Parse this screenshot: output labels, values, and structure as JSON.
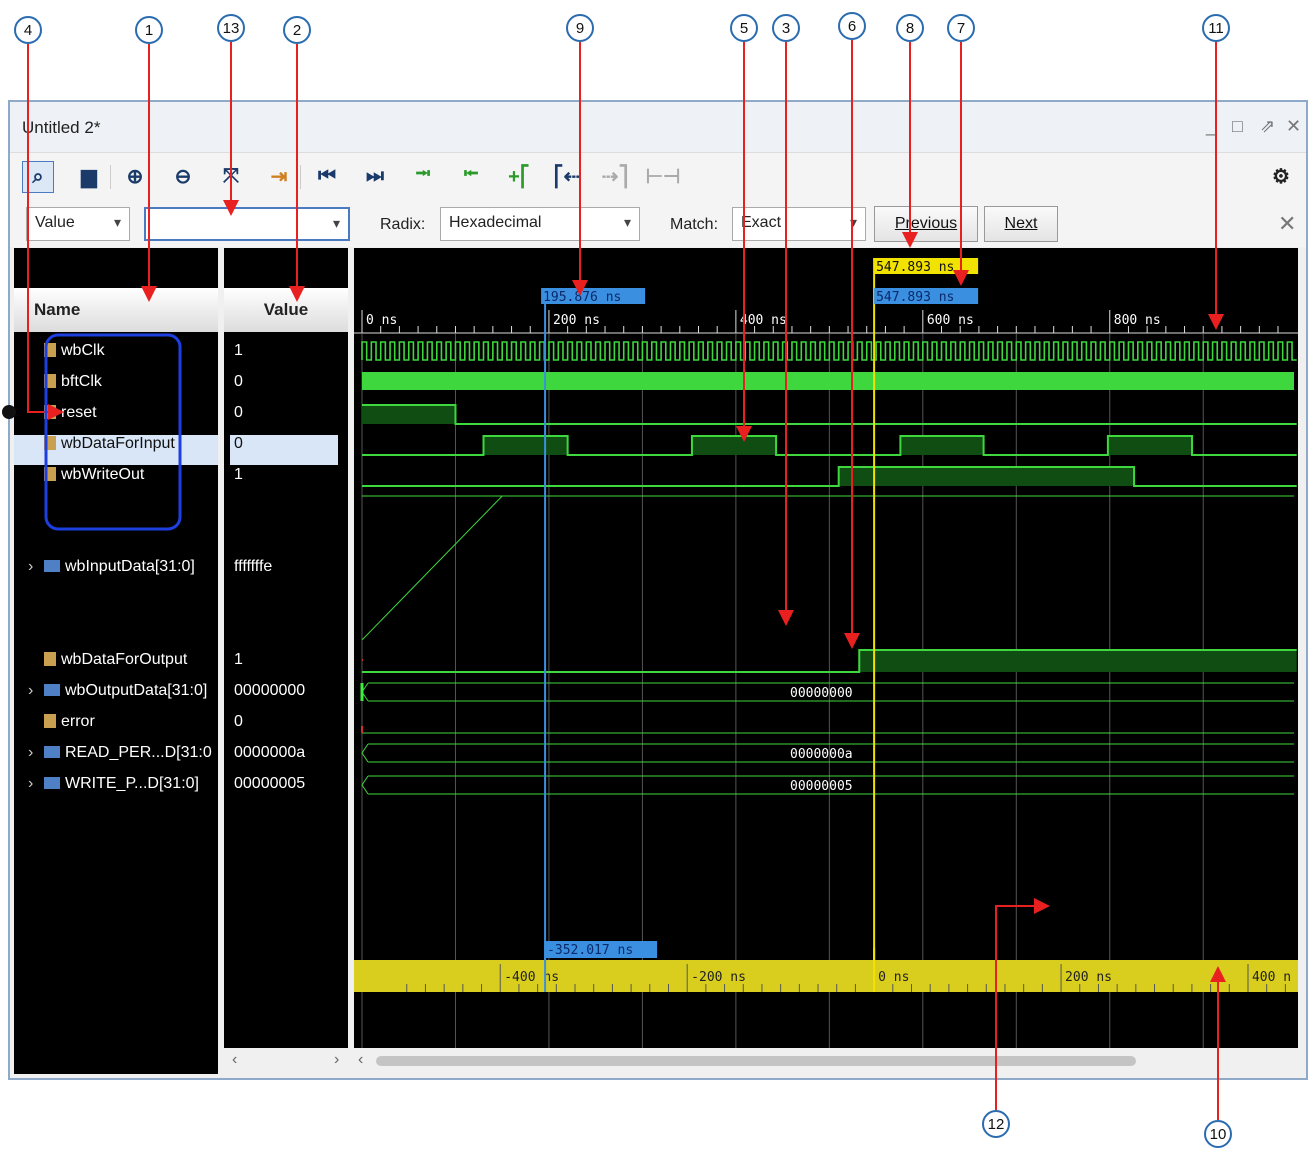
{
  "window": {
    "title": "Untitled 2*"
  },
  "toolbar": {
    "icons": [
      "search-icon",
      "save-icon",
      "zoom-in-icon",
      "zoom-out-icon",
      "zoom-fit-icon",
      "go-to-cursor-icon",
      "go-to-time-0-icon",
      "go-to-last-time-icon",
      "previous-transition-icon",
      "next-transition-icon",
      "add-marker-icon",
      "previous-marker-icon",
      "next-marker-icon",
      "swap-cursors-icon",
      "settings-icon"
    ]
  },
  "findbar": {
    "mode": "Value",
    "search_value": "",
    "radix_label": "Radix:",
    "radix": "Hexadecimal",
    "match_label": "Match:",
    "match": "Exact",
    "previous": "Previous",
    "next": "Next"
  },
  "columns": {
    "name": "Name",
    "value": "Value"
  },
  "signals": [
    {
      "name": "wbClk",
      "value": "1",
      "kind": "bit"
    },
    {
      "name": "bftClk",
      "value": "0",
      "kind": "bit"
    },
    {
      "name": "reset",
      "value": "0",
      "kind": "bit"
    },
    {
      "name": "wbDataForInput",
      "value": "0",
      "kind": "bit"
    },
    {
      "name": "wbWriteOut",
      "value": "1",
      "kind": "bit"
    },
    {
      "name": "wbInputData[31:0]",
      "value": "fffffffe",
      "kind": "bus"
    },
    {
      "name": "wbDataForOutput",
      "value": "1",
      "kind": "bit"
    },
    {
      "name": "wbOutputData[31:0]",
      "value": "00000000",
      "kind": "bus"
    },
    {
      "name": "error",
      "value": "0",
      "kind": "bit"
    },
    {
      "name": "READ_PER...D[31:0",
      "value": "0000000a",
      "kind": "bus"
    },
    {
      "name": "WRITE_P...D[31:0]",
      "value": "00000005",
      "kind": "bus"
    }
  ],
  "bus_labels": [
    "00000000",
    "0000000a",
    "00000005"
  ],
  "timeline": {
    "top_ticks": [
      "0 ns",
      "200 ns",
      "400 ns",
      "600 ns",
      "800 ns"
    ],
    "cursor_time": "195.876 ns",
    "marker_time_top": "547.893 ns",
    "marker_time": "547.893 ns",
    "delta_time": "-352.017 ns",
    "bottom_ticks": [
      "-400 ns",
      "-200 ns",
      "0 ns",
      "200 ns",
      "400 n"
    ]
  },
  "callouts": [
    "1",
    "2",
    "3",
    "4",
    "5",
    "6",
    "7",
    "8",
    "9",
    "10",
    "11",
    "12",
    "13"
  ],
  "colors": {
    "wave_green": "#3ed83e",
    "wave_fill": "#0f4d12",
    "cursor_blue": "#3a8fe0",
    "marker_yellow": "#f2e200",
    "annotation_red": "#e82020",
    "grid": "#555555"
  }
}
